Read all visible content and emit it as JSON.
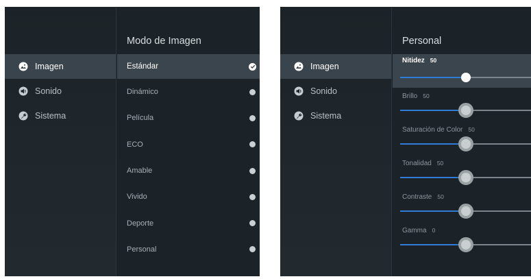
{
  "screens": [
    {
      "sidebar": {
        "items": [
          {
            "label": "Imagen",
            "icon": "image-icon",
            "active": true
          },
          {
            "label": "Sonido",
            "icon": "speaker-icon",
            "active": false
          },
          {
            "label": "Sistema",
            "icon": "wrench-icon",
            "active": false
          }
        ]
      },
      "panel": {
        "title": "Modo de Imagen",
        "options": [
          {
            "label": "Estándar",
            "selected": true
          },
          {
            "label": "Dinámico",
            "selected": false
          },
          {
            "label": "Película",
            "selected": false
          },
          {
            "label": "ECO",
            "selected": false
          },
          {
            "label": "Amable",
            "selected": false
          },
          {
            "label": "Vivido",
            "selected": false
          },
          {
            "label": "Deporte",
            "selected": false
          },
          {
            "label": "Personal",
            "selected": false
          }
        ]
      }
    },
    {
      "sidebar": {
        "items": [
          {
            "label": "Imagen",
            "icon": "image-icon",
            "active": true
          },
          {
            "label": "Sonido",
            "icon": "speaker-icon",
            "active": false
          },
          {
            "label": "Sistema",
            "icon": "wrench-icon",
            "active": false
          }
        ]
      },
      "panel": {
        "title": "Personal",
        "sliders": [
          {
            "label": "Nitidez",
            "value": "50",
            "level": 0.5,
            "active": true
          },
          {
            "label": "Brillo",
            "value": "50",
            "level": 0.5,
            "active": false
          },
          {
            "label": "Saturación de Color",
            "value": "50",
            "level": 0.5,
            "active": false
          },
          {
            "label": "Tonalidad",
            "value": "50",
            "level": 0.5,
            "active": false
          },
          {
            "label": "Contraste",
            "value": "50",
            "level": 0.5,
            "active": false
          },
          {
            "label": "Gamma",
            "value": "0",
            "level": 0.5,
            "active": false
          }
        ]
      }
    }
  ],
  "colors": {
    "accent": "#2f7cd6",
    "background": "#1c2328",
    "highlight": "#3b454d"
  }
}
